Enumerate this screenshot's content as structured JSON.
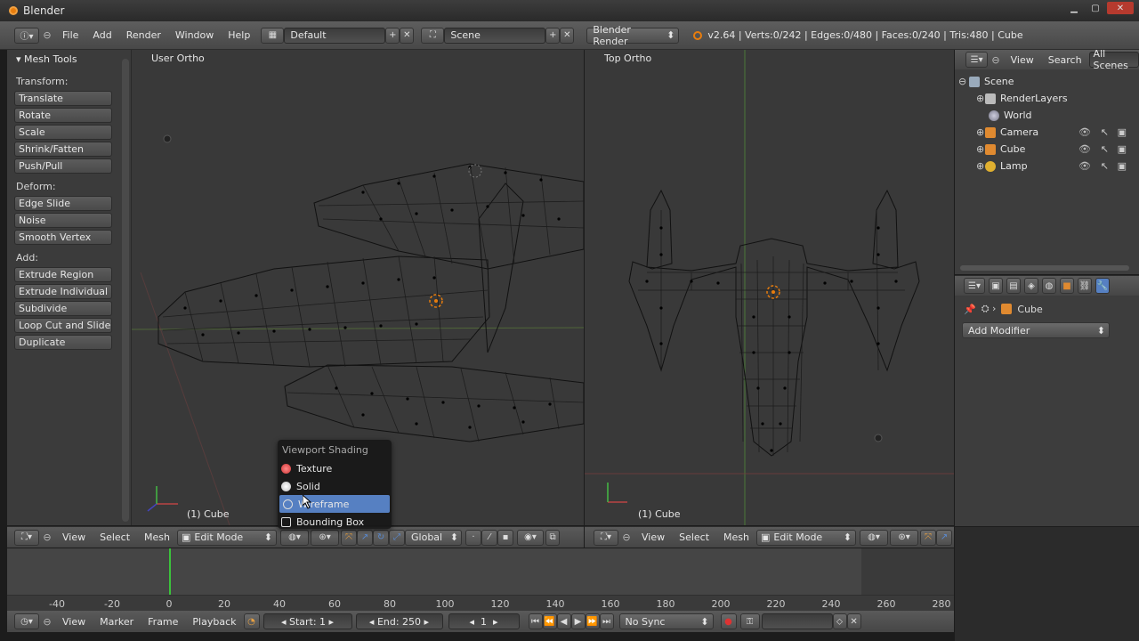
{
  "os_window": {
    "title": "Blender"
  },
  "info_header": {
    "menus": [
      "File",
      "Add",
      "Render",
      "Window",
      "Help"
    ],
    "screen_layout": "Default",
    "scene": "Scene",
    "render_engine": "Blender Render",
    "stats": "v2.64 | Verts:0/242 | Edges:0/480 | Faces:0/240 | Tris:480 | Cube"
  },
  "tool_shelf": {
    "title": "Mesh Tools",
    "groups": [
      {
        "label": "Transform:",
        "buttons": [
          "Translate",
          "Rotate",
          "Scale",
          "Shrink/Fatten",
          "Push/Pull"
        ]
      },
      {
        "label": "Deform:",
        "buttons": [
          "Edge Slide",
          "Noise",
          "Smooth Vertex"
        ]
      },
      {
        "label": "Add:",
        "buttons": [
          "Extrude Region",
          "Extrude Individual",
          "Subdivide",
          "Loop Cut and Slide",
          "Duplicate"
        ]
      }
    ]
  },
  "viewport_left": {
    "label": "User Ortho",
    "object": "(1) Cube"
  },
  "viewport_right": {
    "label": "Top Ortho",
    "object": "(1) Cube"
  },
  "view3d_header_left": {
    "menus": [
      "View",
      "Select",
      "Mesh"
    ],
    "mode": "Edit Mode",
    "orientation": "Global"
  },
  "view3d_header_right": {
    "menus": [
      "View",
      "Select",
      "Mesh"
    ],
    "mode": "Edit Mode"
  },
  "shading_menu": {
    "title": "Viewport Shading",
    "items": [
      "Texture",
      "Solid",
      "Wireframe",
      "Bounding Box"
    ],
    "active": "Wireframe"
  },
  "outliner": {
    "menus": [
      "View",
      "Search"
    ],
    "filter": "All Scenes",
    "items": [
      "Scene",
      "RenderLayers",
      "World",
      "Camera",
      "Cube",
      "Lamp"
    ]
  },
  "properties": {
    "object": "Cube",
    "add_modifier": "Add Modifier"
  },
  "timeline": {
    "ticks": [
      "-40",
      "-20",
      "0",
      "20",
      "40",
      "60",
      "80",
      "100",
      "120",
      "140",
      "160",
      "180",
      "200",
      "220",
      "240",
      "260",
      "280"
    ],
    "menus": [
      "View",
      "Marker",
      "Frame",
      "Playback"
    ],
    "start": "Start: 1",
    "end": "End: 250",
    "current": "1",
    "sync": "No Sync"
  },
  "colors": {
    "accent": "#5680c2",
    "orange": "#e87d0d",
    "viewport_bg": "#393939"
  }
}
